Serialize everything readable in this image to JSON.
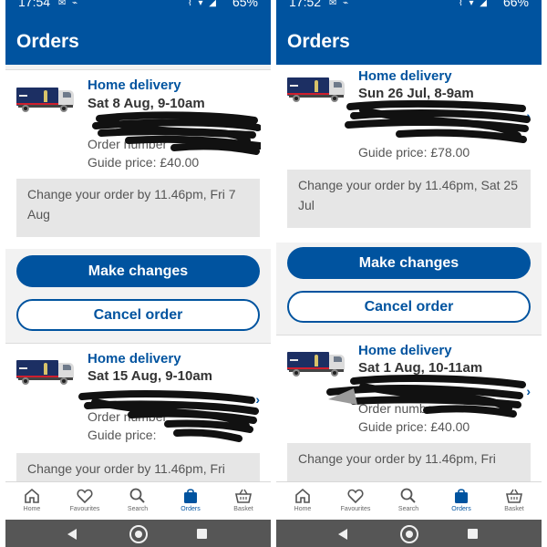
{
  "left": {
    "status": {
      "time": "17:54",
      "battery": "65%"
    },
    "title": "Orders",
    "cards": [
      {
        "delivery_type": "Home delivery",
        "slot": "Sat 8 Aug, 9-10am",
        "order_number_label": "Order number",
        "guide_price": "Guide price: £40.00",
        "notice": "Change your order by 11.46pm, Fri 7 Aug",
        "make_changes": "Make changes",
        "cancel_order": "Cancel order"
      },
      {
        "delivery_type": "Home delivery",
        "slot": "Sat 15 Aug, 9-10am",
        "order_number_label": "Order number",
        "guide_price": "Guide price:",
        "notice": "Change your order by 11.46pm, Fri"
      }
    ]
  },
  "right": {
    "status": {
      "time": "17:52",
      "battery": "66%"
    },
    "title": "Orders",
    "cards": [
      {
        "delivery_type": "Home delivery",
        "slot": "Sun 26 Jul, 8-9am",
        "guide_price": "Guide price: £78.00",
        "notice": "Change your order by 11.46pm, Sat 25 Jul",
        "make_changes": "Make changes",
        "cancel_order": "Cancel order"
      },
      {
        "delivery_type": "Home delivery",
        "slot": "Sat 1 Aug, 10-11am",
        "order_number_label": "Order number",
        "guide_price": "Guide price: £40.00",
        "notice": "Change your order by 11.46pm, Fri"
      }
    ]
  },
  "nav": {
    "home": "Home",
    "favourites": "Favourites",
    "search": "Search",
    "orders": "Orders",
    "basket": "Basket"
  },
  "colors": {
    "brand_blue": "#00539f",
    "redaction": "#111111",
    "notice_bg": "#e6e6e6"
  },
  "icons": [
    "home-icon",
    "heart-icon",
    "search-icon",
    "shopping-bag-icon",
    "basket-icon",
    "chevron-right-icon",
    "delivery-van-icon"
  ]
}
